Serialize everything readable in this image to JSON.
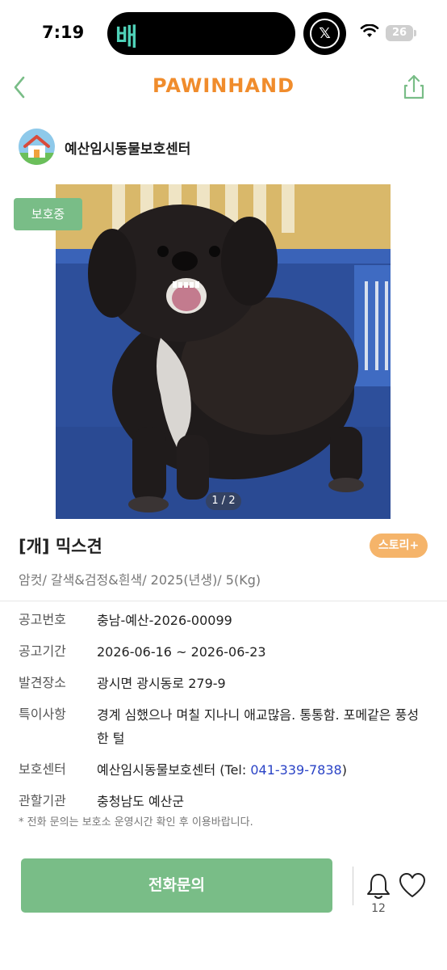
{
  "status_bar": {
    "time": "7:19",
    "island_app_glyph": "배",
    "x_icon_glyph": "𝕏",
    "battery": "26"
  },
  "header": {
    "brand": "PAWINHAND",
    "back_icon": "chevron-left-icon",
    "share_icon": "share-icon",
    "accent_color": "#79bd87",
    "brand_color": "#f08c2c"
  },
  "shelter": {
    "name": "예산임시동물보호센터"
  },
  "photo": {
    "status_tag": "보호중",
    "page_indicator": "1 / 2"
  },
  "animal": {
    "title": "[개] 믹스견",
    "story_button": "스토리+",
    "subtitle": "암컷/ 갈색&검정&흰색/ 2025(년생)/ 5(Kg)"
  },
  "info": {
    "notice_no_label": "공고번호",
    "notice_no": "충남-예산-2026-00099",
    "period_label": "공고기간",
    "period": "2026-06-16 ~ 2026-06-23",
    "found_label": "발견장소",
    "found": "광시면 광시동로 279-9",
    "feature_label": "특이사항",
    "feature": "경계 심했으나 며칠 지나니 애교많음. 통통함. 포메같은 풍성한 털",
    "center_label": "보호센터",
    "center_name": "예산임시동물보호센터 (Tel: ",
    "center_tel": "041-339-7838",
    "center_close": ")",
    "agency_label": "관할기관",
    "agency": "충청남도 예산군"
  },
  "notice": "* 전화 문의는 보호소 운영시간 확인 후 이용바랍니다.",
  "bottom": {
    "call_button": "전화문의",
    "bell_count": "12"
  }
}
